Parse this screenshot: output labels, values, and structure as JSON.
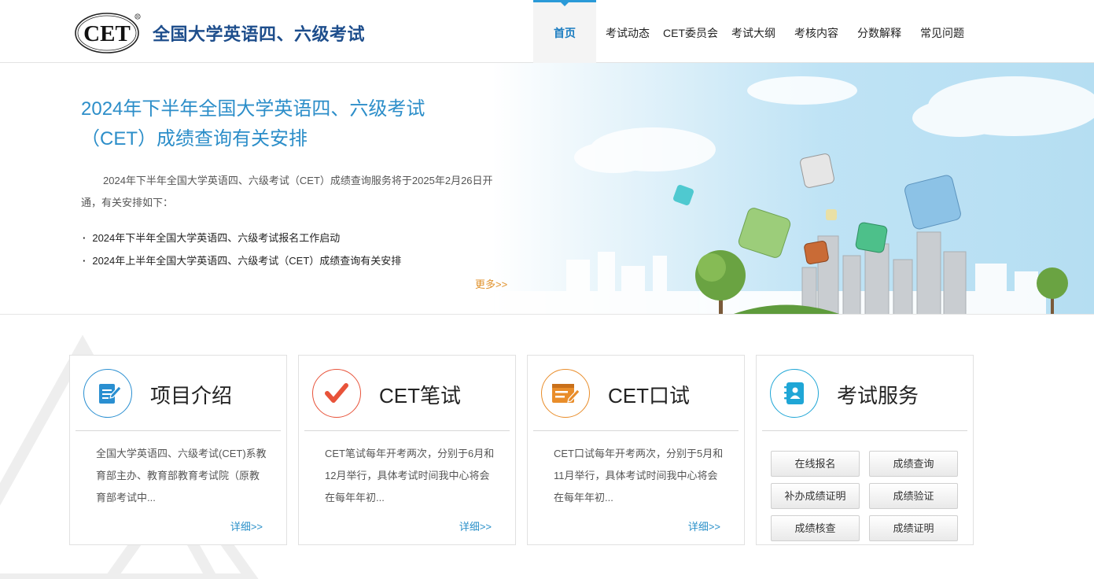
{
  "header": {
    "logo_text": "CET",
    "site_title": "全国大学英语四、六级考试",
    "nav": [
      {
        "label": "首页",
        "active": true
      },
      {
        "label": "考试动态"
      },
      {
        "label": "CET委员会"
      },
      {
        "label": "考试大纲"
      },
      {
        "label": "考核内容"
      },
      {
        "label": "分数解释"
      },
      {
        "label": "常见问题"
      }
    ]
  },
  "banner": {
    "title": "2024年下半年全国大学英语四、六级考试（CET）成绩查询有关安排",
    "description": "2024年下半年全国大学英语四、六级考试（CET）成绩查询服务将于2025年2月26日开通，有关安排如下：",
    "news": [
      "2024年下半年全国大学英语四、六级考试报名工作启动",
      "2024年上半年全国大学英语四、六级考试（CET）成绩查询有关安排"
    ],
    "more": "更多>>"
  },
  "cards": [
    {
      "title": "项目介绍",
      "icon": "document-edit-icon",
      "color": "#2a8fd1",
      "text": "全国大学英语四、六级考试(CET)系教育部主办、教育部教育考试院（原教育部考试中...",
      "more": "详细>>"
    },
    {
      "title": "CET笔试",
      "icon": "checkmark-icon",
      "color": "#e8533a",
      "text": "CET笔试每年开考两次，分别于6月和12月举行，具体考试时间我中心将会在每年年初...",
      "more": "详细>>"
    },
    {
      "title": "CET口试",
      "icon": "form-edit-icon",
      "color": "#e98d2a",
      "text": "CET口试每年开考两次，分别于5月和11月举行，具体考试时间我中心将会在每年年初...",
      "more": "详细>>"
    },
    {
      "title": "考试服务",
      "icon": "contact-book-icon",
      "color": "#1fa6d6",
      "services": [
        "在线报名",
        "成绩查询",
        "补办成绩证明",
        "成绩验证",
        "成绩核查",
        "成绩证明"
      ]
    }
  ]
}
